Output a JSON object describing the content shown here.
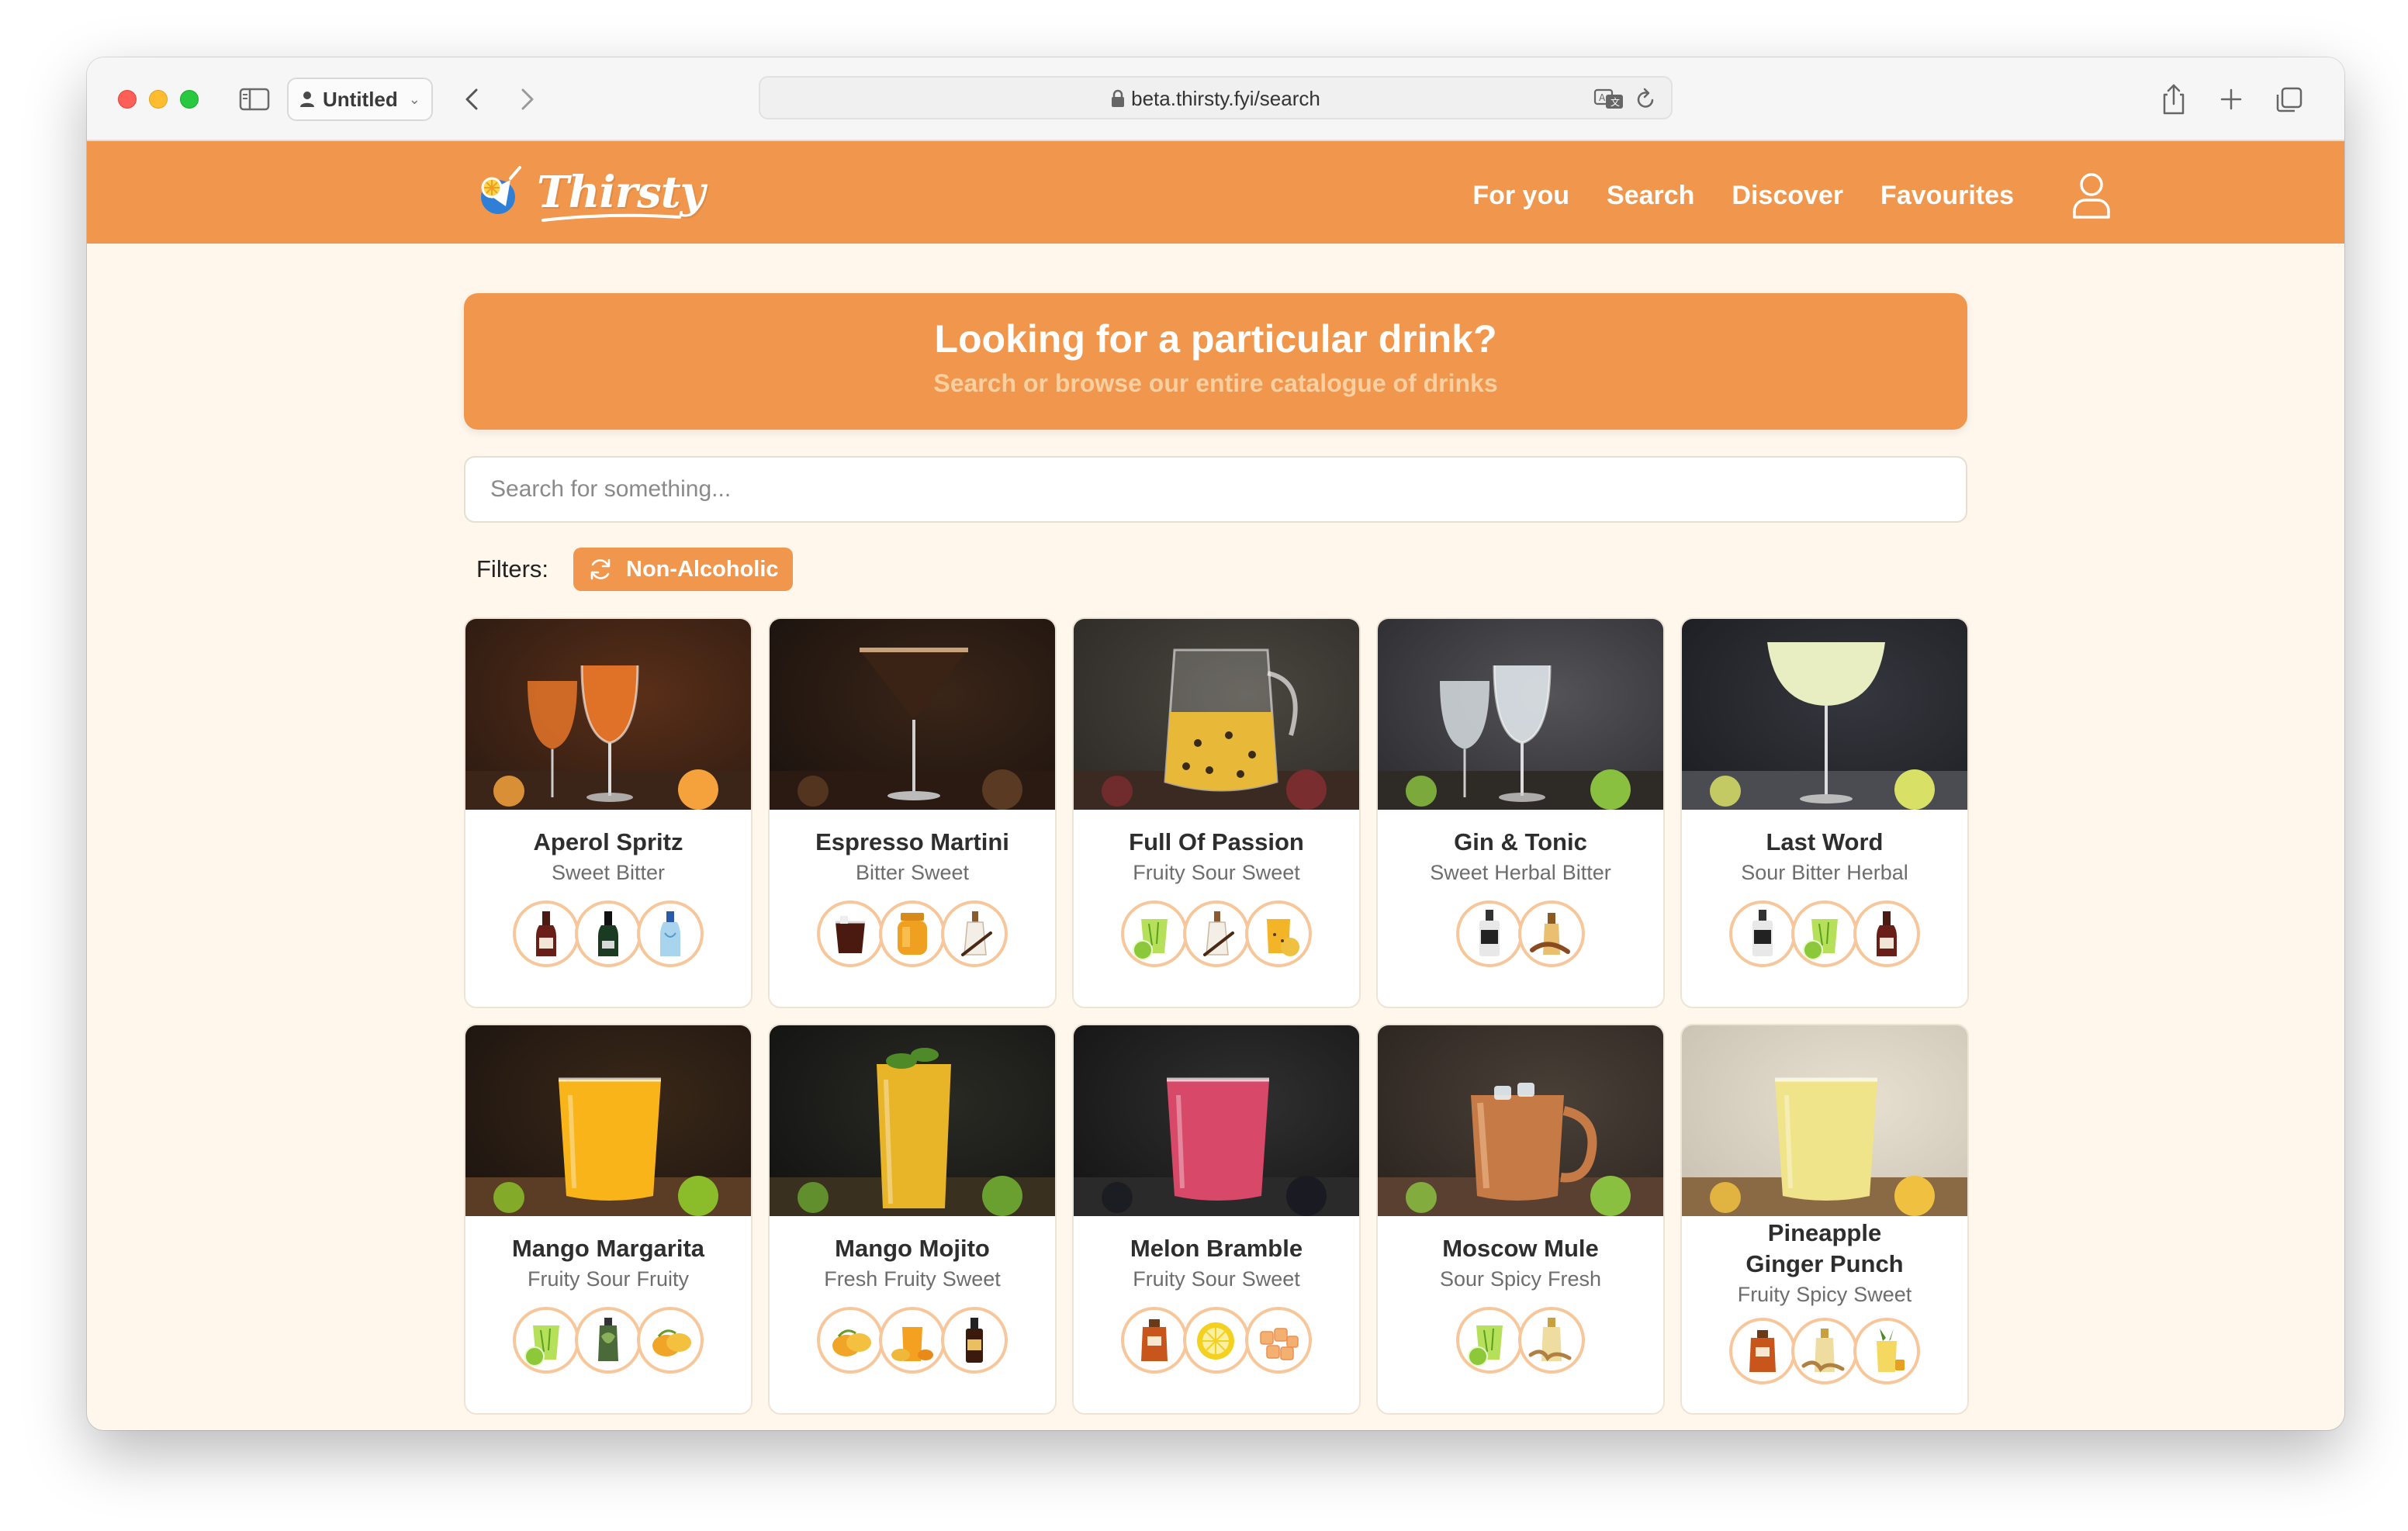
{
  "browser": {
    "profile_name": "Untitled",
    "url": "beta.thirsty.fyi/search"
  },
  "site": {
    "brand": "Thirsty",
    "nav": [
      "For you",
      "Search",
      "Discover",
      "Favourites"
    ]
  },
  "hero": {
    "title": "Looking for a particular drink?",
    "subtitle": "Search or browse our entire catalogue of drinks"
  },
  "search": {
    "placeholder": "Search for something...",
    "value": ""
  },
  "filters": {
    "label": "Filters:",
    "chips": [
      "Non-Alcoholic"
    ]
  },
  "colors": {
    "brand_orange": "#f0974d",
    "page_bg": "#fff6ec",
    "ingredient_ring": "#f7c79b"
  },
  "drinks": [
    {
      "name": "Aperol Spritz",
      "tags": [
        "Sweet",
        "Bitter"
      ],
      "ingredients": [
        "red-wine-bottle",
        "green-wine-bottle",
        "soda-water-bottle"
      ],
      "scene": "orange-spritz"
    },
    {
      "name": "Espresso Martini",
      "tags": [
        "Bitter",
        "Sweet"
      ],
      "ingredients": [
        "coffee-liqueur-glass",
        "honey-jar",
        "vanilla-bottle"
      ],
      "scene": "espresso-martini"
    },
    {
      "name": "Full Of Passion",
      "tags": [
        "Fruity",
        "Sour",
        "Sweet"
      ],
      "ingredients": [
        "lime-juice",
        "vanilla-bottle",
        "passionfruit-juice"
      ],
      "scene": "passionfruit-pitcher"
    },
    {
      "name": "Gin & Tonic",
      "tags": [
        "Sweet",
        "Herbal",
        "Bitter"
      ],
      "ingredients": [
        "gin-bottle",
        "bitters-bottle"
      ],
      "scene": "gin-tonic"
    },
    {
      "name": "Last Word",
      "tags": [
        "Sour",
        "Bitter",
        "Herbal"
      ],
      "ingredients": [
        "gin-bottle",
        "lime-juice",
        "red-wine-bottle"
      ],
      "scene": "last-word"
    },
    {
      "name": "Mango Margarita",
      "tags": [
        "Fruity",
        "Sour",
        "Fruity"
      ],
      "ingredients": [
        "lime-juice",
        "artichoke-liqueur",
        "mango"
      ],
      "scene": "mango-margarita"
    },
    {
      "name": "Mango Mojito",
      "tags": [
        "Fresh",
        "Fruity",
        "Sweet"
      ],
      "ingredients": [
        "mango",
        "mango-juice",
        "rum-bottle"
      ],
      "scene": "mango-mojito"
    },
    {
      "name": "Melon Bramble",
      "tags": [
        "Fruity",
        "Sour",
        "Sweet"
      ],
      "ingredients": [
        "syrup-jar",
        "lemon",
        "melon-cubes"
      ],
      "scene": "melon-bramble"
    },
    {
      "name": "Moscow Mule",
      "tags": [
        "Sour",
        "Spicy",
        "Fresh"
      ],
      "ingredients": [
        "lime-juice",
        "ginger-beer"
      ],
      "scene": "moscow-mule"
    },
    {
      "name": "Pineapple Ginger Punch",
      "tags": [
        "Fruity",
        "Spicy",
        "Sweet"
      ],
      "ingredients": [
        "syrup-jar",
        "ginger-beer",
        "pineapple-juice"
      ],
      "scene": "pineapple-punch"
    }
  ]
}
